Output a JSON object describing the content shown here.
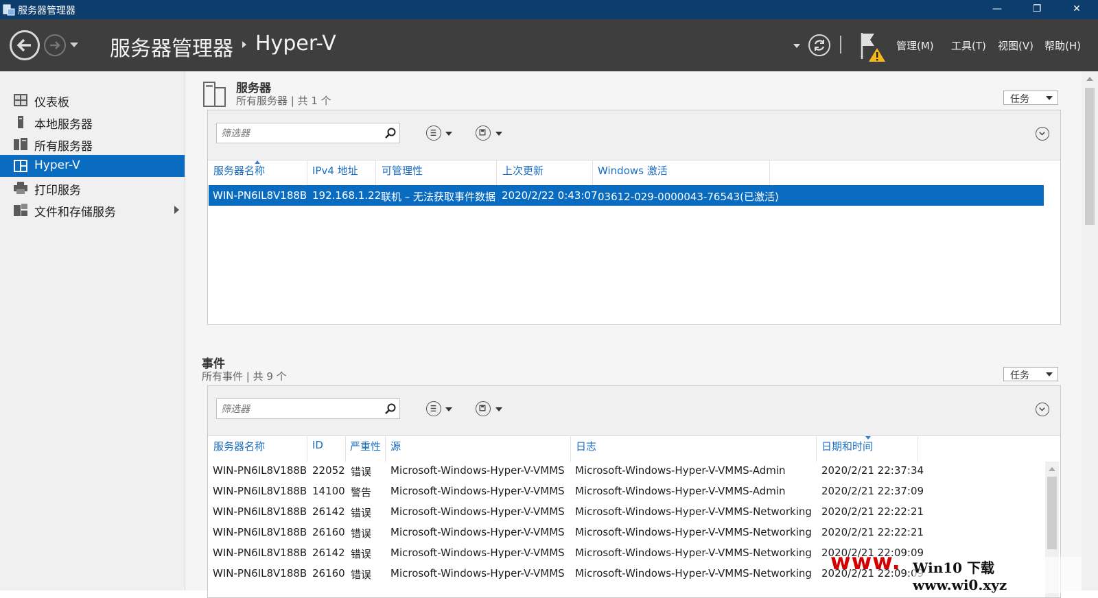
{
  "window": {
    "title": "服务器管理器",
    "minimize": "—",
    "restore": "❐",
    "close": "✕"
  },
  "nav": {
    "breadcrumb_root": "服务器管理器",
    "breadcrumb_current": "Hyper-V",
    "menus": [
      "管理(M)",
      "工具(T)",
      "视图(V)",
      "帮助(H)"
    ]
  },
  "sidebar": {
    "items": [
      {
        "label": "仪表板",
        "icon": "dashboard-icon"
      },
      {
        "label": "本地服务器",
        "icon": "local-server-icon"
      },
      {
        "label": "所有服务器",
        "icon": "all-servers-icon"
      },
      {
        "label": "Hyper-V",
        "icon": "hyperv-icon",
        "active": true
      },
      {
        "label": "打印服务",
        "icon": "printer-icon"
      },
      {
        "label": "文件和存储服务",
        "icon": "file-storage-icon",
        "has_submenu": true
      }
    ]
  },
  "servers": {
    "title": "服务器",
    "subtitle": "所有服务器 | 共 1 个",
    "tasks_label": "任务",
    "filter_placeholder": "筛选器",
    "columns": [
      "服务器名称",
      "IPv4 地址",
      "可管理性",
      "上次更新",
      "Windows 激活"
    ],
    "rows": [
      [
        "WIN-PN6IL8V188B",
        "192.168.1.22",
        "联机 – 无法获取事件数据",
        "2020/2/22 0:43:07",
        "03612-029-0000043-76543(已激活)"
      ]
    ]
  },
  "events": {
    "title": "事件",
    "subtitle": "所有事件 | 共 9 个",
    "tasks_label": "任务",
    "filter_placeholder": "筛选器",
    "columns": [
      "服务器名称",
      "ID",
      "严重性",
      "源",
      "日志",
      "日期和时间"
    ],
    "rows": [
      [
        "WIN-PN6IL8V188B",
        "22052",
        "错误",
        "Microsoft-Windows-Hyper-V-VMMS",
        "Microsoft-Windows-Hyper-V-VMMS-Admin",
        "2020/2/21 22:37:34"
      ],
      [
        "WIN-PN6IL8V188B",
        "14100",
        "警告",
        "Microsoft-Windows-Hyper-V-VMMS",
        "Microsoft-Windows-Hyper-V-VMMS-Admin",
        "2020/2/21 22:37:09"
      ],
      [
        "WIN-PN6IL8V188B",
        "26142",
        "错误",
        "Microsoft-Windows-Hyper-V-VMMS",
        "Microsoft-Windows-Hyper-V-VMMS-Networking",
        "2020/2/21 22:22:21"
      ],
      [
        "WIN-PN6IL8V188B",
        "26160",
        "错误",
        "Microsoft-Windows-Hyper-V-VMMS",
        "Microsoft-Windows-Hyper-V-VMMS-Networking",
        "2020/2/21 22:22:21"
      ],
      [
        "WIN-PN6IL8V188B",
        "26142",
        "错误",
        "Microsoft-Windows-Hyper-V-VMMS",
        "Microsoft-Windows-Hyper-V-VMMS-Networking",
        "2020/2/21 22:09:09"
      ],
      [
        "WIN-PN6IL8V188B",
        "26160",
        "错误",
        "Microsoft-Windows-Hyper-V-VMMS",
        "Microsoft-Windows-Hyper-V-VMMS-Networking",
        "2020/2/21 22:09:09"
      ]
    ]
  },
  "watermark": {
    "site": "www.",
    "text": "Win10 下载 www.wi0.xyz"
  },
  "colors": {
    "title_bar": "#0c3d6d",
    "nav_bar": "#3e3e3e",
    "selection": "#0a6cc1",
    "header_text": "#1a6dc1"
  }
}
